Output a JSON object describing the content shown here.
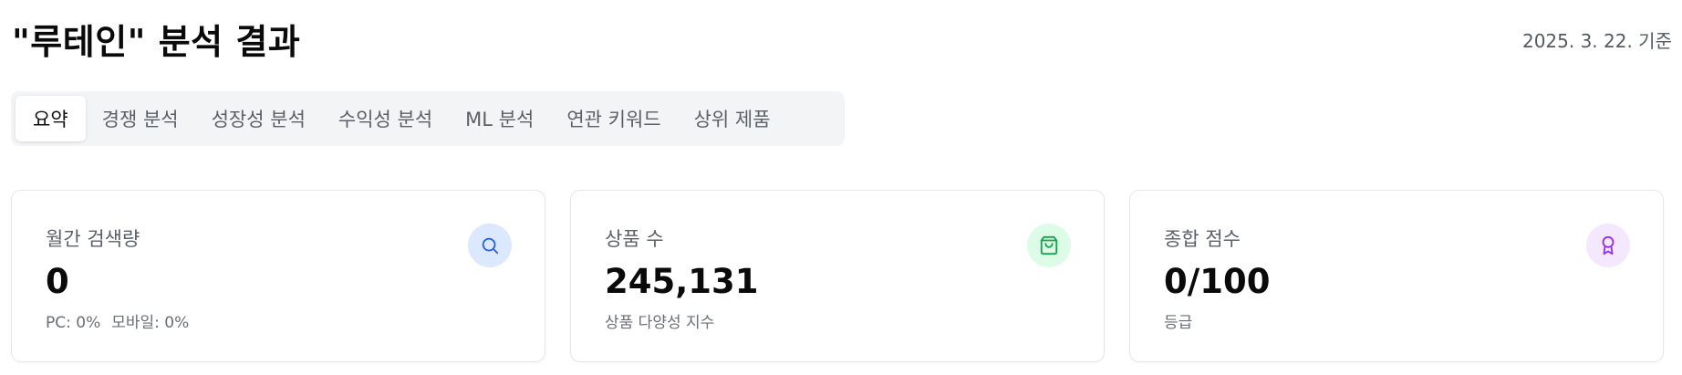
{
  "header": {
    "title": "\"루테인\" 분석 결과",
    "date": "2025. 3. 22. 기준"
  },
  "tabs": [
    {
      "label": "요약",
      "active": true
    },
    {
      "label": "경쟁 분석",
      "active": false
    },
    {
      "label": "성장성 분석",
      "active": false
    },
    {
      "label": "수익성 분석",
      "active": false
    },
    {
      "label": "ML 분석",
      "active": false
    },
    {
      "label": "연관 키워드",
      "active": false
    },
    {
      "label": "상위 제품",
      "active": false
    }
  ],
  "cards": {
    "search_volume": {
      "label": "월간 검색량",
      "value": "0",
      "pc": "PC: 0%",
      "mobile": "모바일: 0%",
      "icon": "search-icon",
      "icon_bg": "#dbe8fe",
      "icon_color": "#2563eb"
    },
    "product_count": {
      "label": "상품 수",
      "value": "245,131",
      "sub": "상품 다양성 지수",
      "icon": "shopping-bag-icon",
      "icon_bg": "#dcfce7",
      "icon_color": "#16a34a"
    },
    "total_score": {
      "label": "종합 점수",
      "value": "0/100",
      "sub": "등급",
      "icon": "award-icon",
      "icon_bg": "#f3e8ff",
      "icon_color": "#9333ea"
    }
  }
}
